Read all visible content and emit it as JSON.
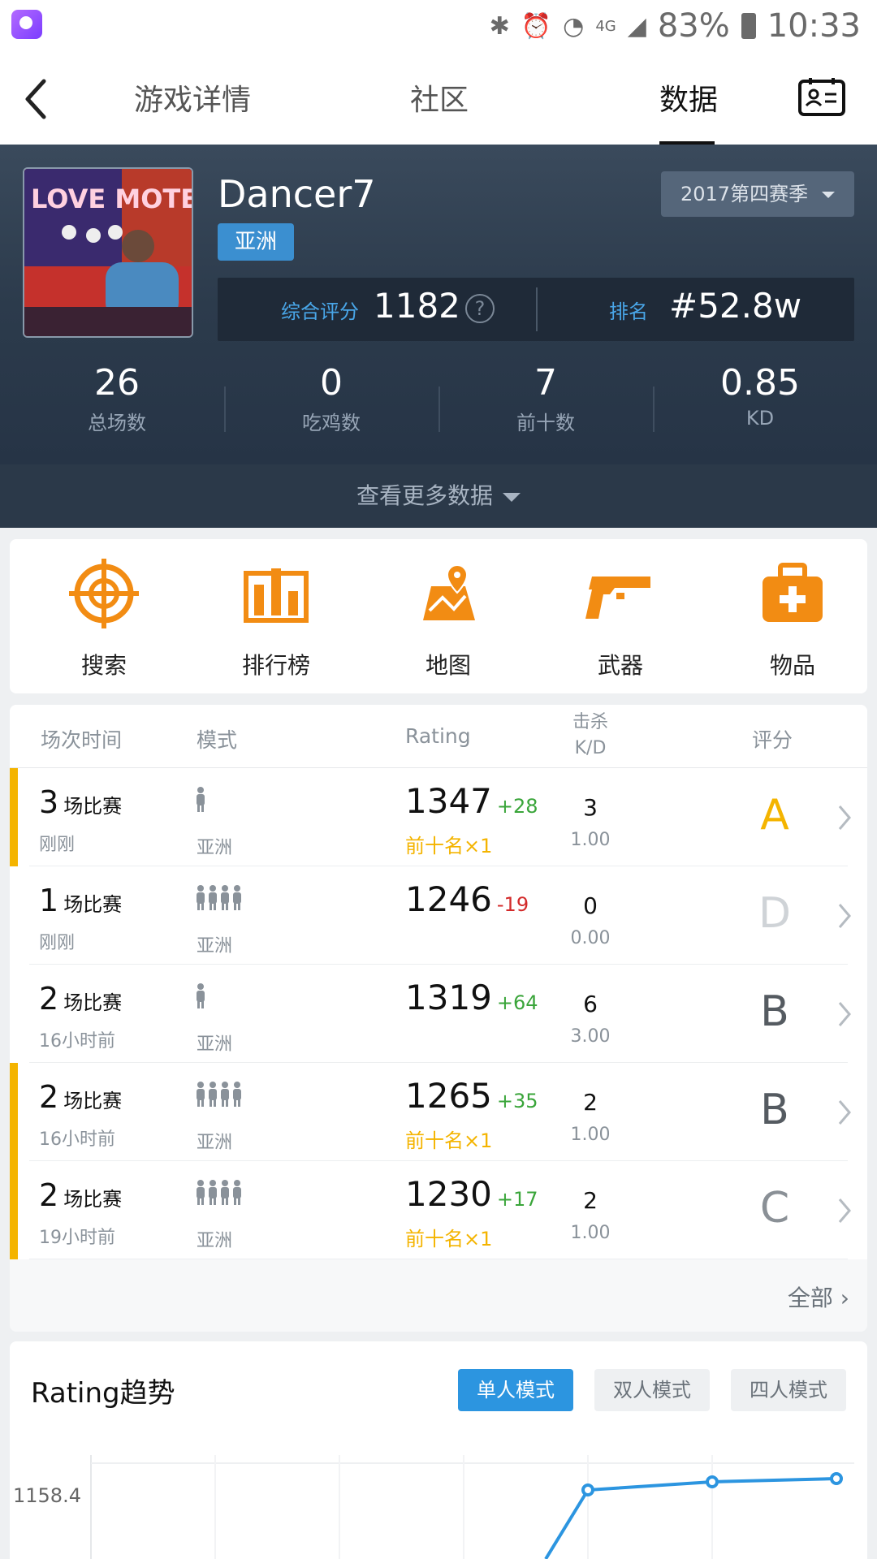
{
  "status_bar": {
    "battery": "83%",
    "time": "10:33",
    "network": "4G"
  },
  "nav": {
    "tabs": [
      {
        "label": "游戏详情"
      },
      {
        "label": "社区"
      },
      {
        "label": "数据"
      }
    ],
    "active_tab": "数据"
  },
  "profile": {
    "name": "Dancer7",
    "region": "亚洲",
    "season": "2017第四赛季",
    "score_label": "综合评分",
    "score": "1182",
    "rank_label": "排名",
    "rank": "#52.8w",
    "stats": [
      {
        "value": "26",
        "label": "总场数"
      },
      {
        "value": "0",
        "label": "吃鸡数"
      },
      {
        "value": "7",
        "label": "前十数"
      },
      {
        "value": "0.85",
        "label": "KD"
      }
    ],
    "more_label": "查看更多数据"
  },
  "menu": [
    {
      "label": "搜索",
      "icon": "crosshair-icon"
    },
    {
      "label": "排行榜",
      "icon": "leaderboard-icon"
    },
    {
      "label": "地图",
      "icon": "map-icon"
    },
    {
      "label": "武器",
      "icon": "pistol-icon"
    },
    {
      "label": "物品",
      "icon": "medkit-icon"
    }
  ],
  "matches": {
    "headers": {
      "time": "场次时间",
      "mode": "模式",
      "rating": "Rating",
      "kills_top": "击杀",
      "kills_bottom": "K/D",
      "grade": "评分"
    },
    "rows": [
      {
        "count": "3",
        "unit": "场比赛",
        "when": "刚刚",
        "mode": "亚洲",
        "mode_type": "solo",
        "rating": "1347",
        "delta": "+28",
        "top10": "前十名×1",
        "kills": "3",
        "kd": "1.00",
        "grade": "A",
        "grade_color": "#f4b400",
        "highlight": true
      },
      {
        "count": "1",
        "unit": "场比赛",
        "when": "刚刚",
        "mode": "亚洲",
        "mode_type": "squad",
        "rating": "1246",
        "delta": "-19",
        "top10": "",
        "kills": "0",
        "kd": "0.00",
        "grade": "D",
        "grade_color": "#cfd3d7",
        "highlight": false
      },
      {
        "count": "2",
        "unit": "场比赛",
        "when": "16小时前",
        "mode": "亚洲",
        "mode_type": "solo",
        "rating": "1319",
        "delta": "+64",
        "top10": "",
        "kills": "6",
        "kd": "3.00",
        "grade": "B",
        "grade_color": "#555b61",
        "highlight": false
      },
      {
        "count": "2",
        "unit": "场比赛",
        "when": "16小时前",
        "mode": "亚洲",
        "mode_type": "squad",
        "rating": "1265",
        "delta": "+35",
        "top10": "前十名×1",
        "kills": "2",
        "kd": "1.00",
        "grade": "B",
        "grade_color": "#555b61",
        "highlight": true
      },
      {
        "count": "2",
        "unit": "场比赛",
        "when": "19小时前",
        "mode": "亚洲",
        "mode_type": "squad",
        "rating": "1230",
        "delta": "+17",
        "top10": "前十名×1",
        "kills": "2",
        "kd": "1.00",
        "grade": "C",
        "grade_color": "#8a9096",
        "highlight": true
      }
    ],
    "all_label": "全部"
  },
  "trend": {
    "title": "Rating趋势",
    "modes": [
      "单人模式",
      "双人模式",
      "四人模式"
    ],
    "active_mode": "单人模式",
    "y_tick": "1158.4"
  },
  "colors": {
    "accent": "#2c95e0",
    "orange": "#f28c13",
    "gold": "#f4b400",
    "up": "#3aa53a",
    "down": "#d32a2a"
  }
}
